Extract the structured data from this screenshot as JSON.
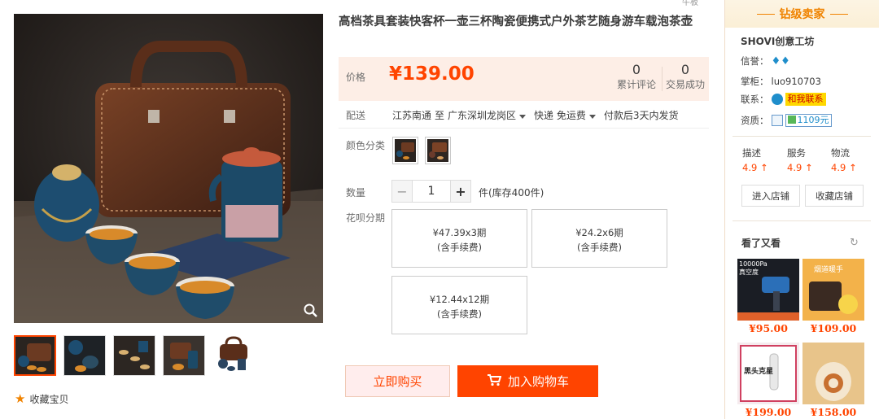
{
  "product": {
    "title": "高档茶具套装快客杯一壶三杯陶瓷便携式户外茶艺随身游车载泡茶壶",
    "top_cut_text": "牛板",
    "price_label": "价格",
    "price": "¥139.00",
    "reviews_count": "0",
    "reviews_label": "累计评论",
    "trades_count": "0",
    "trades_label": "交易成功",
    "shipping_label": "配送",
    "ship_from": "江苏南通",
    "ship_to_word": "至",
    "ship_to": "广东深圳龙岗区",
    "express": "快递 免运费",
    "ship_time": "付款后3天内发货",
    "color_label": "颜色分类",
    "qty_label": "数量",
    "qty_minus": "−",
    "qty_value": "1",
    "qty_plus": "+",
    "stock": "件(库存400件)",
    "installment_label": "花呗分期",
    "installments": [
      {
        "amount": "¥47.39x3期",
        "fee": "(含手续费)"
      },
      {
        "amount": "¥24.2x6期",
        "fee": "(含手续费)"
      },
      {
        "amount": "¥12.44x12期",
        "fee": "(含手续费)"
      }
    ],
    "buy_now": "立即购买",
    "add_cart": "加入购物车",
    "favorite": "收藏宝贝"
  },
  "seller": {
    "level": "钻级卖家",
    "shop_name": "SHOVI创意工坊",
    "credit_label": "信誉：",
    "owner_label": "掌柜：",
    "owner": "luo910703",
    "contact_label": "联系：",
    "contact_btn": "和我联系",
    "qual_label": "资质：",
    "deposit": "1109元",
    "ratings": [
      {
        "label": "描述",
        "value": "4.9 ↑"
      },
      {
        "label": "服务",
        "value": "4.9 ↑"
      },
      {
        "label": "物流",
        "value": "4.9 ↑"
      }
    ],
    "enter_shop": "进入店铺",
    "fav_shop": "收藏店铺",
    "also_viewed": "看了又看",
    "refresh_icon": "↻",
    "recommendations": [
      {
        "price": "¥95.00",
        "img_text": "10000Pa 真空度"
      },
      {
        "price": "¥109.00",
        "img_text": "烟道暖手"
      },
      {
        "price": "¥199.00",
        "img_text": "黑头克星"
      },
      {
        "price": "¥158.00",
        "img_text": ""
      }
    ]
  },
  "colors": {
    "accent": "#ff4400",
    "price_bg": "#fdeee6",
    "seller_gold": "#f08300"
  }
}
